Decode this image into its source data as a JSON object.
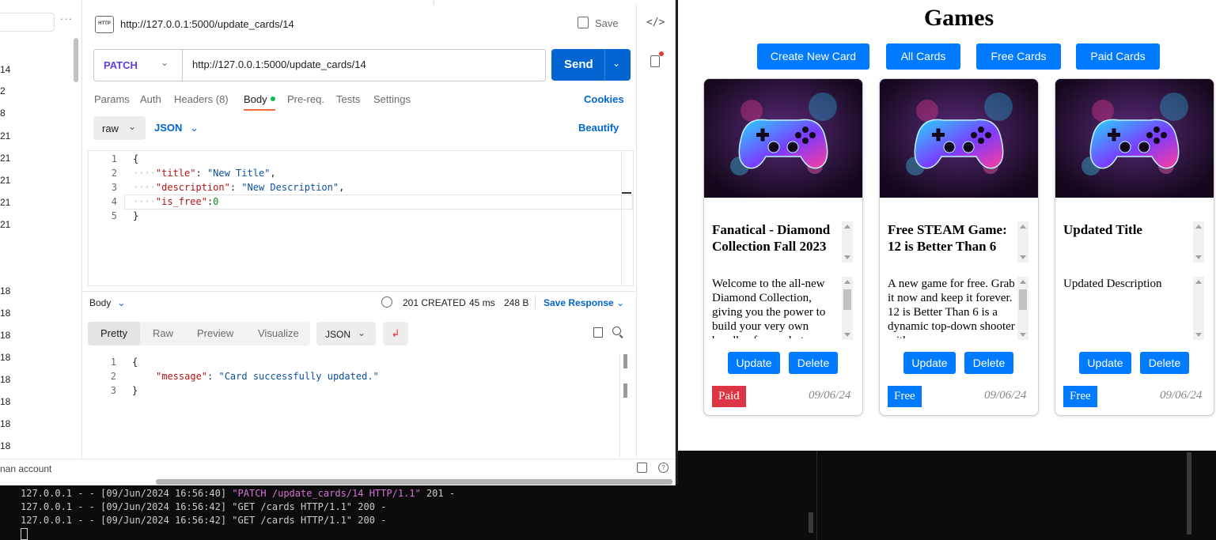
{
  "terminal": {
    "lines": [
      {
        "pre": "127.0.0.1 - - [09/Jun/2024 16:56:40] ",
        "highlight": "\"PATCH /update_cards/14 HTTP/1.1\"",
        "post": " 201 -"
      },
      {
        "pre": "127.0.0.1 - - [09/Jun/2024 16:56:42] \"GET /cards HTTP/1.1\" 200 -",
        "highlight": "",
        "post": ""
      },
      {
        "pre": "127.0.0.1 - - [09/Jun/2024 16:56:42] \"GET /cards HTTP/1.1\" 200 -",
        "highlight": "",
        "post": ""
      }
    ]
  },
  "sidebar": {
    "numbers": [
      "14",
      "2",
      "8",
      "21",
      "21",
      "21",
      "21",
      "21",
      "18",
      "18",
      "18",
      "18",
      "18",
      "18",
      "18",
      "18"
    ],
    "bottom_text": "nan account"
  },
  "request": {
    "icon_text": "HTTP",
    "title": "http://127.0.0.1:5000/update_cards/14",
    "save_label": "Save",
    "method": "PATCH",
    "url": "http://127.0.0.1:5000/update_cards/14",
    "send_label": "Send",
    "tabs": [
      "Params",
      "Auth",
      "Headers (8)",
      "Body",
      "Pre-req.",
      "Tests",
      "Settings"
    ],
    "cookies_label": "Cookies",
    "body_mode": "raw",
    "body_format": "JSON",
    "beautify_label": "Beautify",
    "body_lines": [
      {
        "num": "1",
        "indent": "",
        "key": "",
        "sep": "",
        "value": "",
        "value_type": "",
        "tail": "{"
      },
      {
        "num": "2",
        "indent": "····",
        "key": "\"title\"",
        "sep": ": ",
        "value": "\"New Title\"",
        "value_type": "str",
        "tail": ","
      },
      {
        "num": "3",
        "indent": "····",
        "key": "\"description\"",
        "sep": ": ",
        "value": "\"New Description\"",
        "value_type": "str",
        "tail": ","
      },
      {
        "num": "4",
        "indent": "····",
        "key": "\"is_free\"",
        "sep": ":",
        "value": "0",
        "value_type": "num",
        "tail": ""
      },
      {
        "num": "5",
        "indent": "",
        "key": "",
        "sep": "",
        "value": "",
        "value_type": "",
        "tail": "}"
      }
    ]
  },
  "response": {
    "body_label": "Body",
    "status": "201 CREATED",
    "time": "45 ms",
    "size": "248 B",
    "save_label": "Save Response",
    "view_tabs": [
      "Pretty",
      "Raw",
      "Preview",
      "Visualize"
    ],
    "format": "JSON",
    "lines": [
      {
        "num": "1",
        "key": "",
        "sep": "",
        "value": "",
        "tail": "{"
      },
      {
        "num": "2",
        "key": "\"message\"",
        "sep": ": ",
        "value": "\"Card successfully updated.\"",
        "tail": ""
      },
      {
        "num": "3",
        "key": "",
        "sep": "",
        "value": "",
        "tail": "}"
      }
    ]
  },
  "games": {
    "title": "Games",
    "nav": [
      "Create New Card",
      "All Cards",
      "Free Cards",
      "Paid Cards"
    ],
    "update_label": "Update",
    "delete_label": "Delete",
    "cards": [
      {
        "title": "Fanatical - Diamond Collection Fall 2023",
        "description": "Welcome to the all-new Diamond Collection, giving you the power to build your very own bundle of super hot",
        "badge": "Paid",
        "badge_color": "#dc3545",
        "date": "09/06/24",
        "title_scroll": true,
        "desc_scroll": true
      },
      {
        "title": "Free STEAM Game: 12 is Better Than 6",
        "description": "A new game for free. Grab it now and keep it forever. 12 is Better Than 6 is a dynamic top-down shooter with",
        "badge": "Free",
        "badge_color": "#007bff",
        "date": "09/06/24",
        "title_scroll": true,
        "desc_scroll": true
      },
      {
        "title": "Updated Title",
        "description": "Updated Description",
        "badge": "Free",
        "badge_color": "#007bff",
        "date": "09/06/24",
        "title_scroll": false,
        "desc_scroll": false
      }
    ]
  }
}
